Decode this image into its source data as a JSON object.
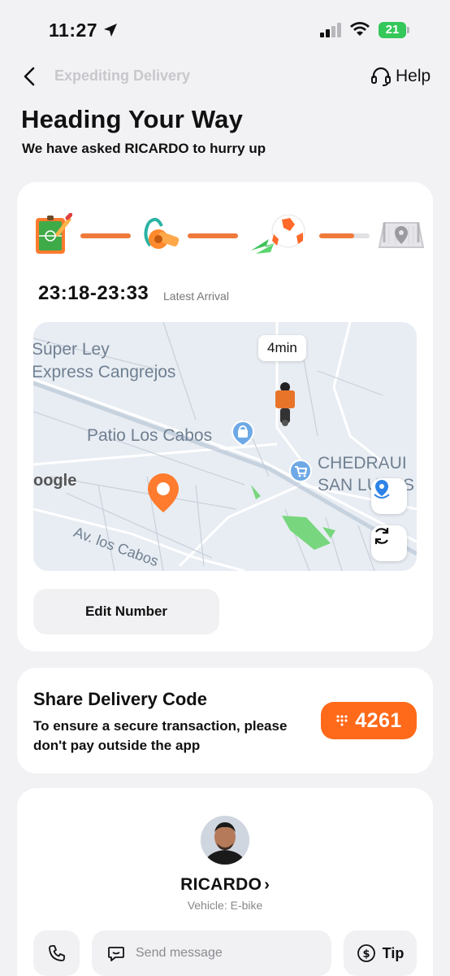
{
  "status_bar": {
    "time": "11:27",
    "battery": "21"
  },
  "nav": {
    "title": "Expediting Delivery",
    "help_label": "Help"
  },
  "header": {
    "title": "Heading Your Way",
    "subtitle": "We have asked RICARDO to hurry up"
  },
  "progress": {
    "steps": [
      "field-icon",
      "whistle-icon",
      "soccer-ball-icon",
      "goal-icon"
    ],
    "last_bar_fraction": 0.7,
    "arrival_window": "23:18-23:33",
    "arrival_label": "Latest Arrival"
  },
  "map": {
    "eta": "4min",
    "labels": {
      "super_ley": "Súper Ley",
      "express": "Express Cangrejos",
      "patio": "Patio Los Cabos",
      "chedraui": "CHEDRAUI",
      "san_lucas": "SAN LUCAS",
      "google": "oogle",
      "av": "Av. los Cabos"
    }
  },
  "edit_number_label": "Edit Number",
  "delivery_code": {
    "title": "Share Delivery Code",
    "description": "To ensure a secure transaction, please don't pay outside the app",
    "code": "4261",
    "accent": "#ff6a1a"
  },
  "rider": {
    "name": "RICARDO",
    "chevron": "›",
    "vehicle": "Vehicle: E-bike",
    "message_placeholder": "Send message",
    "tip_label": "Tip"
  }
}
